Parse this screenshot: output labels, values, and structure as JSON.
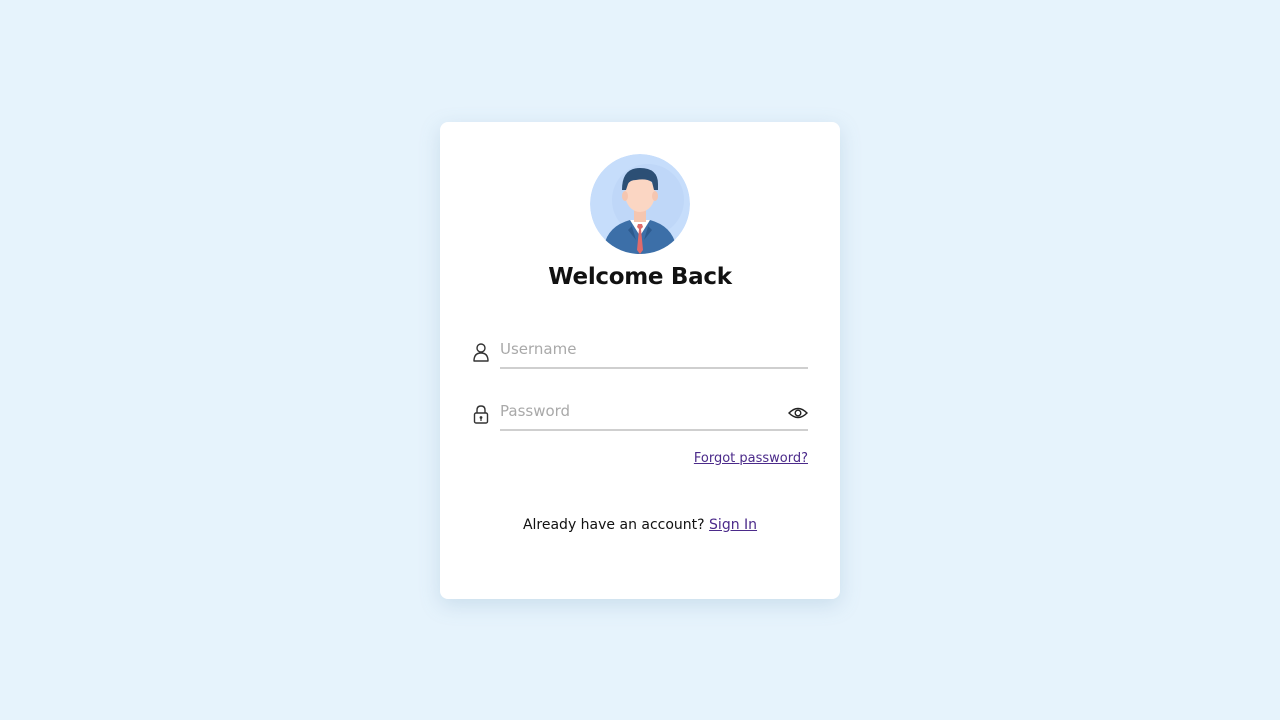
{
  "card": {
    "title": "Welcome Back",
    "avatar_icon": "businessman-avatar-icon",
    "username": {
      "icon": "user-icon",
      "placeholder": "Username",
      "value": ""
    },
    "password": {
      "icon": "lock-icon",
      "placeholder": "Password",
      "value": "",
      "toggle_icon": "eye-icon"
    },
    "forgot_link": "Forgot password?",
    "footer_text": "Already have an account?",
    "signin_link": "Sign In"
  },
  "colors": {
    "background": "#e6f3fc",
    "card": "#ffffff",
    "link": "#4b2a8a",
    "underline": "#cfcfcf"
  }
}
